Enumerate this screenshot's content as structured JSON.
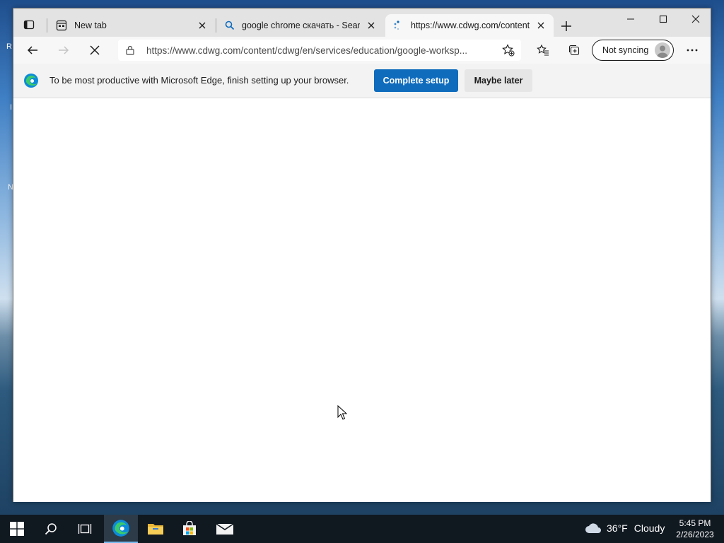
{
  "desktop": {
    "left_fragments": [
      "R",
      "I",
      "N"
    ]
  },
  "tabs": [
    {
      "title": "New tab",
      "icon": "newtab-page-icon",
      "active": false
    },
    {
      "title": "google chrome скачать - Search",
      "icon": "search-icon",
      "active": false
    },
    {
      "title": "https://www.cdwg.com/content/",
      "icon": "loading-icon",
      "active": true
    }
  ],
  "toolbar": {
    "url": "https://www.cdwg.com/content/cdwg/en/services/education/google-worksp...",
    "sync_label": "Not syncing"
  },
  "infobar": {
    "message": "To be most productive with Microsoft Edge, finish setting up your browser.",
    "primary_label": "Complete setup",
    "secondary_label": "Maybe later"
  },
  "taskbar": {
    "weather_temp": "36°F",
    "weather_text": "Cloudy",
    "time": "5:45 PM",
    "date": "2/26/2023"
  },
  "colors": {
    "accent": "#0f6cbd",
    "taskbar": "#101820"
  }
}
